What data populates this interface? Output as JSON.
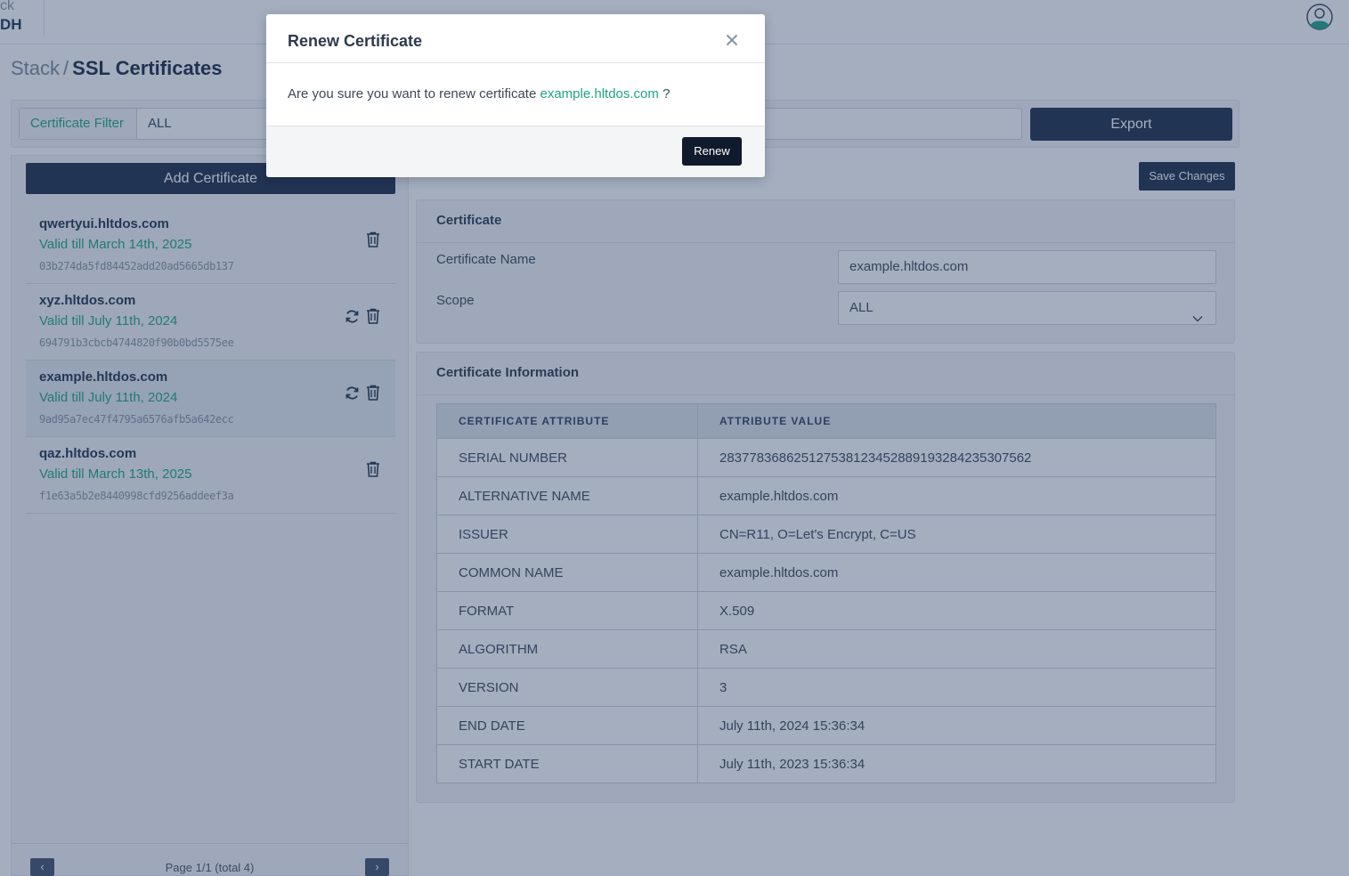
{
  "header": {
    "brand_top": "ck",
    "brand_bottom": "DH"
  },
  "breadcrumb": {
    "parent": "Stack",
    "separator": "/",
    "current": "SSL Certificates"
  },
  "filter": {
    "label": "Certificate Filter",
    "value": "ALL",
    "export_label": "Export"
  },
  "sidebar": {
    "add_label": "Add Certificate",
    "items": [
      {
        "name": "qwertyui.hltdos.com",
        "valid": "Valid till March 14th, 2025",
        "hash": "03b274da5fd84452add20ad5665db137",
        "has_renew": false
      },
      {
        "name": "xyz.hltdos.com",
        "valid": "Valid till July 11th, 2024",
        "hash": "694791b3cbcb4744820f90b0bd5575ee",
        "has_renew": true
      },
      {
        "name": "example.hltdos.com",
        "valid": "Valid till July 11th, 2024",
        "hash": "9ad95a7ec47f4795a6576afb5a642ecc",
        "has_renew": true,
        "selected": true
      },
      {
        "name": "qaz.hltdos.com",
        "valid": "Valid till March 13th, 2025",
        "hash": "f1e63a5b2e8440998cfd9256addeef3a",
        "has_renew": false
      }
    ],
    "pager": {
      "text": "Page 1/1 (total 4)",
      "prev": "‹",
      "next": "›"
    }
  },
  "save_label": "Save Changes",
  "certificate_card": {
    "title": "Certificate",
    "name_label": "Certificate Name",
    "name_value": "example.hltdos.com",
    "scope_label": "Scope",
    "scope_value": "ALL"
  },
  "info_card": {
    "title": "Certificate Information",
    "columns": [
      "CERTIFICATE ATTRIBUTE",
      "ATTRIBUTE VALUE"
    ],
    "rows": [
      [
        "SERIAL NUMBER",
        "283778368625127538123452889193284235307562"
      ],
      [
        "ALTERNATIVE NAME",
        "example.hltdos.com"
      ],
      [
        "ISSUER",
        "CN=R11, O=Let's Encrypt, C=US"
      ],
      [
        "COMMON NAME",
        "example.hltdos.com"
      ],
      [
        "FORMAT",
        "X.509"
      ],
      [
        "ALGORITHM",
        "RSA"
      ],
      [
        "VERSION",
        "3"
      ],
      [
        "END DATE",
        "July 11th, 2024 15:36:34"
      ],
      [
        "START DATE",
        "July 11th, 2023 15:36:34"
      ]
    ]
  },
  "modal": {
    "title": "Renew Certificate",
    "text_before": "Are you sure you want to renew certificate",
    "link": "example.hltdos.com",
    "text_after": "?",
    "confirm_label": "Renew"
  },
  "colors": {
    "accent": "#1fa584",
    "primary": "#1f2d48",
    "overlay": "rgba(38,63,102,0.42)"
  }
}
